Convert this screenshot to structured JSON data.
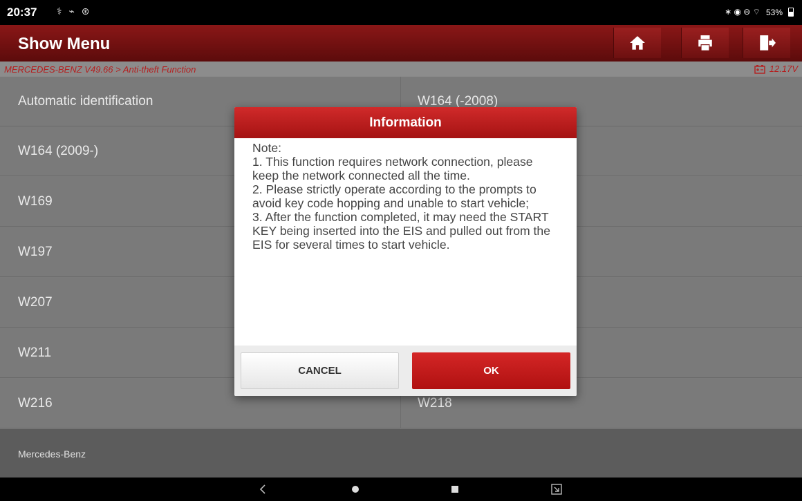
{
  "status_bar": {
    "time": "20:37",
    "left_icons": "⚕ ⌁ ⊛",
    "right_icons": "∗ ◉ ⊖ ⌔",
    "battery": "53%"
  },
  "header": {
    "title": "Show Menu",
    "buttons": [
      "home-icon",
      "print-icon",
      "exit-icon"
    ]
  },
  "breadcrumb": {
    "path": "MERCEDES-BENZ V49.66 > Anti-theft Function",
    "voltage": "12.17V"
  },
  "menu": {
    "left": [
      "Automatic identification",
      "W164 (2009-)",
      "W169",
      "W197",
      "W207",
      "W211",
      "W216"
    ],
    "right": [
      "W164 (-2008)",
      "",
      "",
      "",
      "",
      "",
      "W218"
    ]
  },
  "footer": {
    "label": "Mercedes-Benz"
  },
  "dialog": {
    "title": "Information",
    "body": "Note:\n1. This function requires network connection, please keep the network connected all the time.\n2. Please strictly operate according to the prompts to avoid key code hopping and unable to start vehicle;\n3. After the function completed, it may need the START KEY being inserted into the EIS and pulled out from the EIS for several times to start vehicle.",
    "cancel_label": "CANCEL",
    "ok_label": "OK"
  },
  "colors": {
    "accent": "#b51e1e",
    "header": "#7a1212",
    "ok_button": "#c41a1a"
  }
}
